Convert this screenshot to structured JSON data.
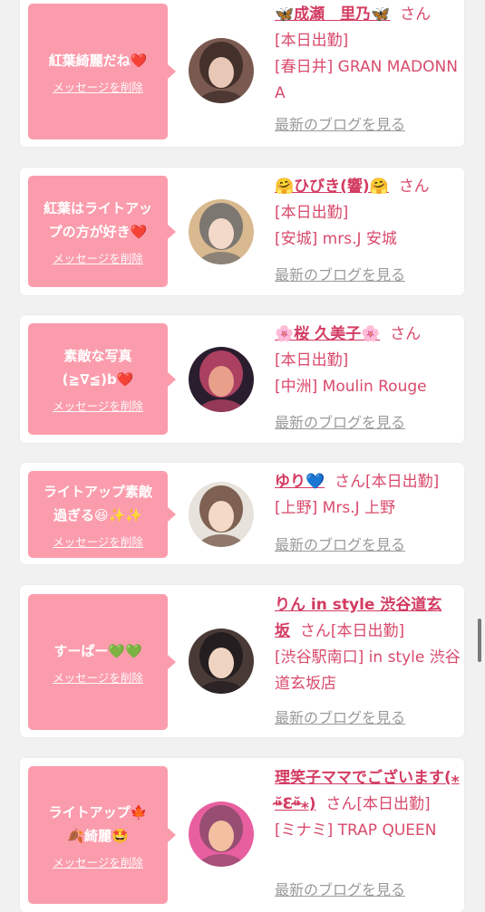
{
  "delete_label": "メッセージを削除",
  "blog_label": "最新のブログを見る",
  "san_label": "さん",
  "cards": [
    {
      "message": "紅葉綺麗だね❤️",
      "name": "🦋成瀬　里乃🦋",
      "status": "[本日出勤]",
      "shop": "[春日井] GRAN MADONNA",
      "avatar_colors": [
        "#7a5a50",
        "#e9c7b6",
        "#3b2a26"
      ]
    },
    {
      "message": "紅葉はライトアッ\nプの方が好き❤️",
      "name": "🤗ひびき(響)🤗",
      "status": "[本日出勤]",
      "shop": "[安城] mrs.J 安城",
      "avatar_colors": [
        "#d9b98f",
        "#f2d9c9",
        "#6b6b6b"
      ]
    },
    {
      "message": "素敵な写真\n(≧∇≦)b❤️",
      "name": "🌸桜 久美子🌸",
      "status": "[本日出勤]",
      "shop": "[中洲] Moulin Rouge",
      "avatar_colors": [
        "#2a1d2e",
        "#e8a08a",
        "#c2466a"
      ]
    },
    {
      "message": "ライトアップ素敵\n過ぎる😆✨✨",
      "name": "ゆり💙",
      "status": "[本日出勤]",
      "shop": "[上野] Mrs.J 上野",
      "avatar_colors": [
        "#e7e2dc",
        "#f3d9c6",
        "#6b4a3a"
      ]
    },
    {
      "message": "すーぱー💚💚",
      "name": "りん in style 渋谷道玄坂",
      "status": "[本日出勤]",
      "shop": "[渋谷駅南口] in style 渋谷道玄坂店",
      "avatar_colors": [
        "#4a3a36",
        "#f0d4c2",
        "#1f1a1c"
      ]
    },
    {
      "message": "ライトアップ🍁\n🍂綺麗🤩",
      "name": "理笑子ママでございます(⁎⁍̴̆Ɛ⁍̴̆⁎)",
      "status": "[本日出勤]",
      "shop": "[ミナミ] TRAP QUEEN",
      "avatar_colors": [
        "#e85fa0",
        "#f2c0a0",
        "#8a4a6a"
      ]
    }
  ]
}
